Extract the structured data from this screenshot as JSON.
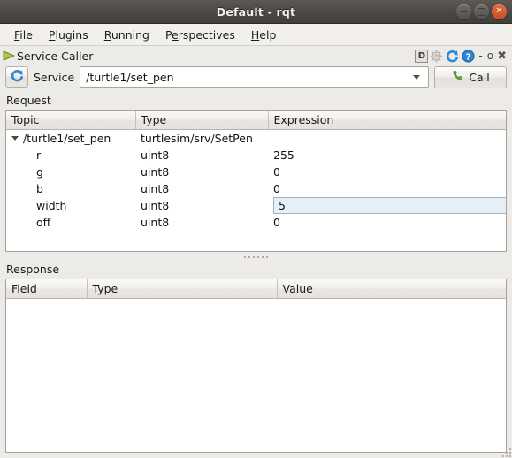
{
  "window": {
    "title": "Default - rqt",
    "buttons": {
      "minimize": "minimize-button",
      "maximize": "maximize-button",
      "close": "close-button"
    }
  },
  "menubar": {
    "items": [
      {
        "label": "File",
        "mnemonic": "F"
      },
      {
        "label": "Plugins",
        "mnemonic": "P"
      },
      {
        "label": "Running",
        "mnemonic": "R"
      },
      {
        "label": "Perspectives",
        "mnemonic": "e"
      },
      {
        "label": "Help",
        "mnemonic": "H"
      }
    ]
  },
  "plugin_panel": {
    "icon": "play-triangle-icon",
    "title": "Service Caller",
    "tools": [
      {
        "name": "dock-d-button",
        "label": "D"
      },
      {
        "name": "settings-gear-icon",
        "label": ""
      },
      {
        "name": "reload-plugin-icon",
        "label": ""
      },
      {
        "name": "help-question-icon",
        "label": ""
      }
    ],
    "window_controls": {
      "minimize": "-",
      "float": "o",
      "close": "✖"
    }
  },
  "service_bar": {
    "refresh_icon": "refresh-icon",
    "label": "Service",
    "selected_service": "/turtle1/set_pen",
    "dropdown_icon": "chevron-down-icon",
    "call_button": {
      "label": "Call",
      "icon": "phone-icon"
    }
  },
  "request": {
    "section_label": "Request",
    "columns": [
      "Topic",
      "Type",
      "Expression"
    ],
    "rows": [
      {
        "topic": "/turtle1/set_pen",
        "type": "turtlesim/srv/SetPen",
        "expression": "",
        "level": 0,
        "expanded": true,
        "editing": false
      },
      {
        "topic": "r",
        "type": "uint8",
        "expression": "255",
        "level": 1,
        "expanded": false,
        "editing": false
      },
      {
        "topic": "g",
        "type": "uint8",
        "expression": "0",
        "level": 1,
        "expanded": false,
        "editing": false
      },
      {
        "topic": "b",
        "type": "uint8",
        "expression": "0",
        "level": 1,
        "expanded": false,
        "editing": false
      },
      {
        "topic": "width",
        "type": "uint8",
        "expression": "5",
        "level": 1,
        "expanded": false,
        "editing": true
      },
      {
        "topic": "off",
        "type": "uint8",
        "expression": "0",
        "level": 1,
        "expanded": false,
        "editing": false
      }
    ]
  },
  "response": {
    "section_label": "Response",
    "columns": [
      "Field",
      "Type",
      "Value"
    ],
    "rows": []
  },
  "colors": {
    "window_background": "#edebe7",
    "titlebar": "#4b4744",
    "close_button": "#d8603a",
    "accent_blue": "#2f7fc4",
    "edit_cell_background": "#e7eff6",
    "call_icon_green": "#6aae33"
  }
}
